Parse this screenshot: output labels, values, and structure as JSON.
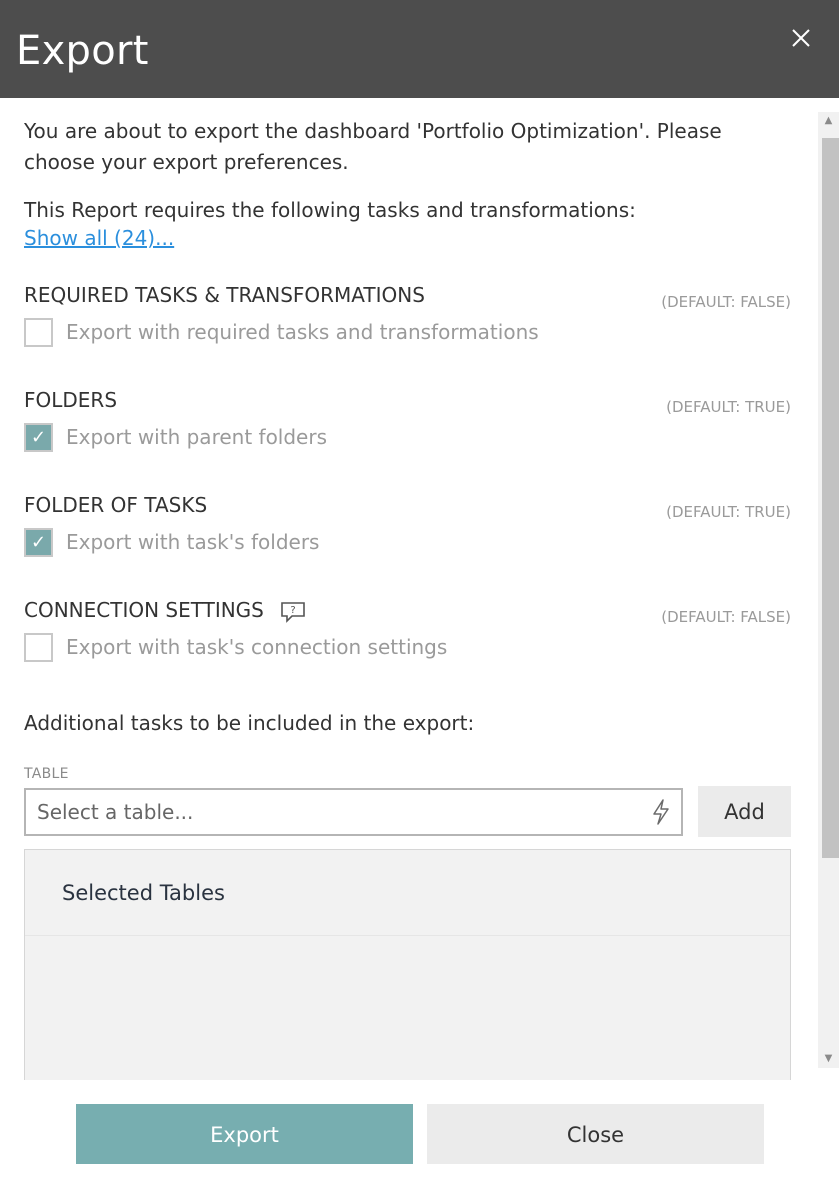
{
  "dialog": {
    "title": "Export",
    "close_icon": "close-icon"
  },
  "intro": {
    "text": "You are about to export the dashboard 'Portfolio Optimization'. Please choose your export preferences.",
    "requires_text": "This Report requires the following tasks and transformations:",
    "show_all_link": "Show all (24)..."
  },
  "sections": [
    {
      "title": "REQUIRED TASKS & TRANSFORMATIONS",
      "default": "(DEFAULT: FALSE)",
      "checkbox_label": "Export with required tasks and transformations",
      "checked": false
    },
    {
      "title": "FOLDERS",
      "default": "(DEFAULT: TRUE)",
      "checkbox_label": "Export with parent folders",
      "checked": true
    },
    {
      "title": "FOLDER OF TASKS",
      "default": "(DEFAULT: TRUE)",
      "checkbox_label": "Export with task's folders",
      "checked": true
    },
    {
      "title": "CONNECTION SETTINGS",
      "default": "(DEFAULT: FALSE)",
      "checkbox_label": "Export with task's connection settings",
      "checked": false,
      "icon": "comment-help-icon"
    }
  ],
  "additional": {
    "label": "Additional tasks to be included in the export:",
    "table_label": "TABLE",
    "table_placeholder": "Select a table...",
    "input_icon": "lightning-bolt-icon",
    "add_button": "Add",
    "selected_title": "Selected Tables"
  },
  "footer": {
    "export_button": "Export",
    "close_button": "Close"
  },
  "colors": {
    "header_bg": "#4d4d4d",
    "accent": "#77aeb0",
    "link": "#2b8fdd"
  }
}
